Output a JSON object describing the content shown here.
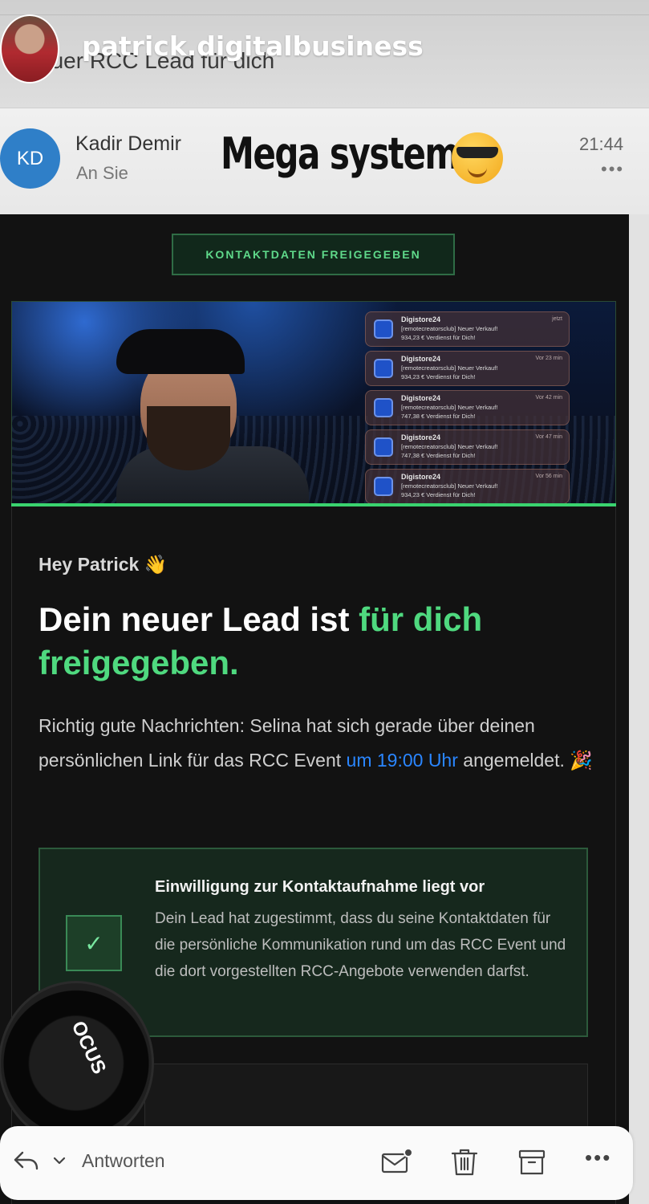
{
  "story": {
    "username": "patrick.digitalbusiness"
  },
  "mail": {
    "subject_partial": "euer RCC Lead für dich",
    "sender_initials": "KD",
    "sender_name": "Kadir Demir",
    "recipient": "An Sie",
    "time": "21:44",
    "more": "•••"
  },
  "sticker": {
    "text": "Mega system"
  },
  "email": {
    "badge": "KONTAKTDATEN FREIGEGEBEN",
    "notifications": [
      {
        "title": "Digistore24",
        "time": "jetzt",
        "line1": "[remotecreatorsclub] Neuer Verkauf!",
        "line2": "934,23 € Verdienst für Dich!"
      },
      {
        "title": "Digistore24",
        "time": "Vor 23 min",
        "line1": "[remotecreatorsclub] Neuer Verkauf!",
        "line2": "934,23 € Verdienst für Dich!"
      },
      {
        "title": "Digistore24",
        "time": "Vor 42 min",
        "line1": "[remotecreatorsclub] Neuer Verkauf!",
        "line2": "747,38 € Verdienst für Dich!"
      },
      {
        "title": "Digistore24",
        "time": "Vor 47 min",
        "line1": "[remotecreatorsclub] Neuer Verkauf!",
        "line2": "747,38 € Verdienst für Dich!"
      },
      {
        "title": "Digistore24",
        "time": "Vor 56 min",
        "line1": "[remotecreatorsclub] Neuer Verkauf!",
        "line2": "934,23 € Verdienst für Dich!"
      }
    ],
    "greeting": "Hey Patrick 👋",
    "headline_part1": "Dein neuer Lead ist ",
    "headline_highlight": "für dich freigegeben.",
    "body_part1": "Richtig gute Nachrichten: Selina hat sich gerade über deinen persönlichen Link für das RCC Event ",
    "body_link": "um 19:00 Uhr",
    "body_part2": " angemeldet. 🎉",
    "consent_check": "✓",
    "consent_title": "Einwilligung zur Kontaktaufnahme liegt vor",
    "consent_text": "Dein Lead hat zugestimmt, dass du seine Kontaktdaten für die persönliche Kommunikation rund um das RCC Event und die dort vorgestellten RCC-Angebote verwenden darfst."
  },
  "overlay": {
    "focus_label": "OCUS"
  },
  "toolbar": {
    "reply_label": "Antworten",
    "more": "•••",
    "icons": [
      "reply-icon",
      "chevron-down-icon",
      "mark-unread-icon",
      "trash-icon",
      "archive-icon",
      "more-icon"
    ]
  },
  "colors": {
    "accent_green": "#4fd97f",
    "link_blue": "#2a86ff",
    "avatar_blue": "#2f7fc8",
    "email_background": "#121212"
  }
}
